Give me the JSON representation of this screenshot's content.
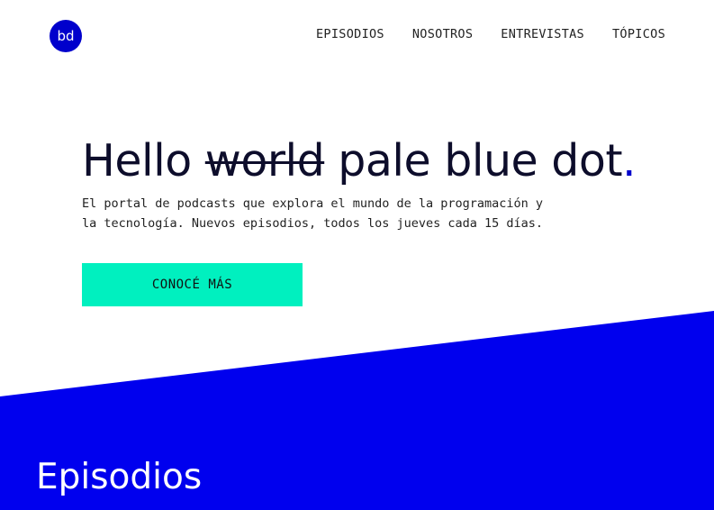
{
  "logo": {
    "text": "bd"
  },
  "nav": {
    "items": [
      {
        "label": "EPISODIOS"
      },
      {
        "label": "NOSOTROS"
      },
      {
        "label": "ENTREVISTAS"
      },
      {
        "label": "TÓPICOS"
      }
    ]
  },
  "hero": {
    "title_start": "Hello",
    "title_strike": "world",
    "title_end": "pale blue dot",
    "title_dot": ".",
    "subtitle_line1": "El portal de podcasts que explora el mundo de la programación y",
    "subtitle_line2": "la tecnología. Nuevos episodios, todos los jueves cada 15 días.",
    "cta_label": "CONOCÉ MÁS"
  },
  "episodes": {
    "section_title": "Episodios"
  },
  "colors": {
    "brand_blue": "#0000ee",
    "logo_blue": "#0000cc",
    "cta_green": "#00f0bf",
    "text_dark": "#0d0d2b"
  }
}
